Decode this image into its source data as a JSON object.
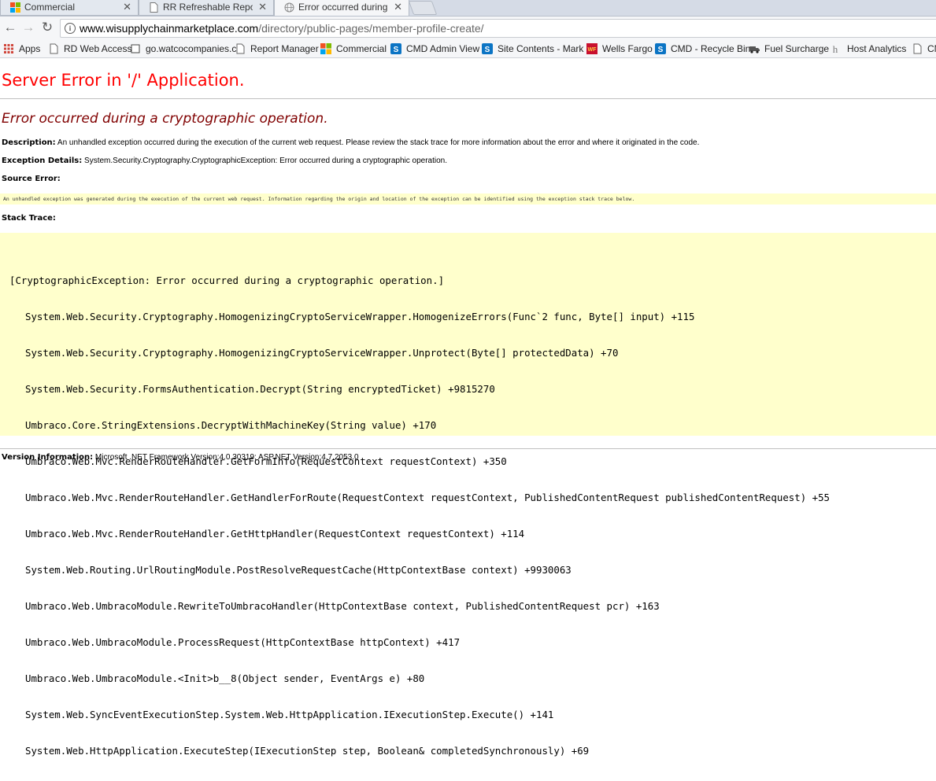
{
  "tabs": [
    {
      "title": "Commercial",
      "close": "✕"
    },
    {
      "title": "RR Refreshable Reports",
      "close": "✕"
    },
    {
      "title": "Error occurred during a c",
      "close": "✕"
    }
  ],
  "nav": {
    "back": "←",
    "forward": "→",
    "reload": "↻"
  },
  "address": {
    "host": "www.wisupplychainmarketplace.com",
    "path": "/directory/public-pages/member-profile-create/"
  },
  "bookmarks": [
    {
      "label": "Apps",
      "icon": "apps-grid-icon"
    },
    {
      "label": "RD Web Access",
      "icon": "page-icon"
    },
    {
      "label": "go.watcocompanies.c",
      "icon": "page-icon"
    },
    {
      "label": "Report Manager",
      "icon": "page-icon"
    },
    {
      "label": "Commercial",
      "icon": "windows-logo-icon"
    },
    {
      "label": "CMD Admin View",
      "icon": "sharepoint-icon"
    },
    {
      "label": "Site Contents - Mark",
      "icon": "sharepoint-icon"
    },
    {
      "label": "Wells Fargo",
      "icon": "wells-fargo-icon"
    },
    {
      "label": "CMD - Recycle Bin",
      "icon": "sharepoint-icon"
    },
    {
      "label": "Fuel Surcharge",
      "icon": "truck-icon"
    },
    {
      "label": "Host Analytics",
      "icon": "h-icon"
    },
    {
      "label": "CM",
      "icon": "page-icon"
    }
  ],
  "error": {
    "title": "Server Error in '/' Application.",
    "subtitle": "Error occurred during a cryptographic operation.",
    "description_label": "Description:",
    "description": "An unhandled exception occurred during the execution of the current web request. Please review the stack trace for more information about the error and where it originated in the code.",
    "exception_label": "Exception Details:",
    "exception": "System.Security.Cryptography.CryptographicException: Error occurred during a cryptographic operation.",
    "source_label": "Source Error:",
    "source_text": "An unhandled exception was generated during the execution of the current web request. Information regarding the origin and location of the exception can be identified using the exception stack trace below.",
    "stack_label": "Stack Trace:",
    "stack_header": "[CryptographicException: Error occurred during a cryptographic operation.]",
    "stack_lines": [
      "System.Web.Security.Cryptography.HomogenizingCryptoServiceWrapper.HomogenizeErrors(Func`2 func, Byte[] input) +115",
      "System.Web.Security.Cryptography.HomogenizingCryptoServiceWrapper.Unprotect(Byte[] protectedData) +70",
      "System.Web.Security.FormsAuthentication.Decrypt(String encryptedTicket) +9815270",
      "Umbraco.Core.StringExtensions.DecryptWithMachineKey(String value) +170",
      "Umbraco.Web.Mvc.RenderRouteHandler.GetFormInfo(RequestContext requestContext) +350",
      "Umbraco.Web.Mvc.RenderRouteHandler.GetHandlerForRoute(RequestContext requestContext, PublishedContentRequest publishedContentRequest) +55",
      "Umbraco.Web.Mvc.RenderRouteHandler.GetHttpHandler(RequestContext requestContext) +114",
      "System.Web.Routing.UrlRoutingModule.PostResolveRequestCache(HttpContextBase context) +9930063",
      "Umbraco.Web.UmbracoModule.RewriteToUmbracoHandler(HttpContextBase context, PublishedContentRequest pcr) +163",
      "Umbraco.Web.UmbracoModule.ProcessRequest(HttpContextBase httpContext) +417",
      "Umbraco.Web.UmbracoModule.<Init>b__8(Object sender, EventArgs e) +80",
      "System.Web.SyncEventExecutionStep.System.Web.HttpApplication.IExecutionStep.Execute() +141",
      "System.Web.HttpApplication.ExecuteStep(IExecutionStep step, Boolean& completedSynchronously) +69"
    ],
    "version_label": "Version Information:",
    "version": "Microsoft .NET Framework Version:4.0.30319; ASP.NET Version:4.7.2053.0"
  }
}
